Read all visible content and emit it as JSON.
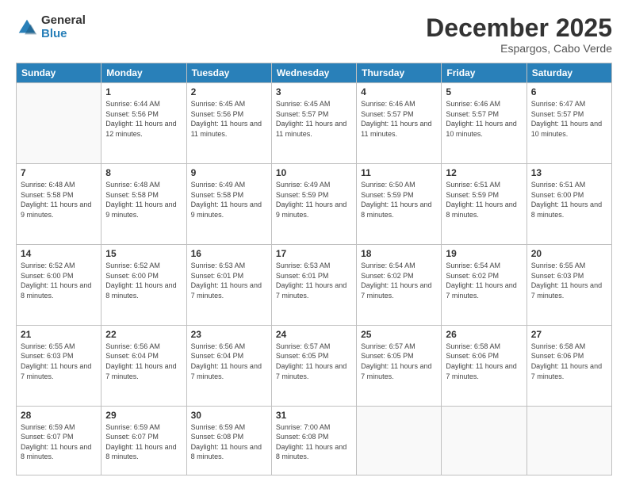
{
  "logo": {
    "general": "General",
    "blue": "Blue"
  },
  "header": {
    "month": "December 2025",
    "location": "Espargos, Cabo Verde"
  },
  "days_of_week": [
    "Sunday",
    "Monday",
    "Tuesday",
    "Wednesday",
    "Thursday",
    "Friday",
    "Saturday"
  ],
  "weeks": [
    [
      {
        "day": "",
        "sunrise": "",
        "sunset": "",
        "daylight": ""
      },
      {
        "day": "1",
        "sunrise": "Sunrise: 6:44 AM",
        "sunset": "Sunset: 5:56 PM",
        "daylight": "Daylight: 11 hours and 12 minutes."
      },
      {
        "day": "2",
        "sunrise": "Sunrise: 6:45 AM",
        "sunset": "Sunset: 5:56 PM",
        "daylight": "Daylight: 11 hours and 11 minutes."
      },
      {
        "day": "3",
        "sunrise": "Sunrise: 6:45 AM",
        "sunset": "Sunset: 5:57 PM",
        "daylight": "Daylight: 11 hours and 11 minutes."
      },
      {
        "day": "4",
        "sunrise": "Sunrise: 6:46 AM",
        "sunset": "Sunset: 5:57 PM",
        "daylight": "Daylight: 11 hours and 11 minutes."
      },
      {
        "day": "5",
        "sunrise": "Sunrise: 6:46 AM",
        "sunset": "Sunset: 5:57 PM",
        "daylight": "Daylight: 11 hours and 10 minutes."
      },
      {
        "day": "6",
        "sunrise": "Sunrise: 6:47 AM",
        "sunset": "Sunset: 5:57 PM",
        "daylight": "Daylight: 11 hours and 10 minutes."
      }
    ],
    [
      {
        "day": "7",
        "sunrise": "Sunrise: 6:48 AM",
        "sunset": "Sunset: 5:58 PM",
        "daylight": "Daylight: 11 hours and 9 minutes."
      },
      {
        "day": "8",
        "sunrise": "Sunrise: 6:48 AM",
        "sunset": "Sunset: 5:58 PM",
        "daylight": "Daylight: 11 hours and 9 minutes."
      },
      {
        "day": "9",
        "sunrise": "Sunrise: 6:49 AM",
        "sunset": "Sunset: 5:58 PM",
        "daylight": "Daylight: 11 hours and 9 minutes."
      },
      {
        "day": "10",
        "sunrise": "Sunrise: 6:49 AM",
        "sunset": "Sunset: 5:59 PM",
        "daylight": "Daylight: 11 hours and 9 minutes."
      },
      {
        "day": "11",
        "sunrise": "Sunrise: 6:50 AM",
        "sunset": "Sunset: 5:59 PM",
        "daylight": "Daylight: 11 hours and 8 minutes."
      },
      {
        "day": "12",
        "sunrise": "Sunrise: 6:51 AM",
        "sunset": "Sunset: 5:59 PM",
        "daylight": "Daylight: 11 hours and 8 minutes."
      },
      {
        "day": "13",
        "sunrise": "Sunrise: 6:51 AM",
        "sunset": "Sunset: 6:00 PM",
        "daylight": "Daylight: 11 hours and 8 minutes."
      }
    ],
    [
      {
        "day": "14",
        "sunrise": "Sunrise: 6:52 AM",
        "sunset": "Sunset: 6:00 PM",
        "daylight": "Daylight: 11 hours and 8 minutes."
      },
      {
        "day": "15",
        "sunrise": "Sunrise: 6:52 AM",
        "sunset": "Sunset: 6:00 PM",
        "daylight": "Daylight: 11 hours and 8 minutes."
      },
      {
        "day": "16",
        "sunrise": "Sunrise: 6:53 AM",
        "sunset": "Sunset: 6:01 PM",
        "daylight": "Daylight: 11 hours and 7 minutes."
      },
      {
        "day": "17",
        "sunrise": "Sunrise: 6:53 AM",
        "sunset": "Sunset: 6:01 PM",
        "daylight": "Daylight: 11 hours and 7 minutes."
      },
      {
        "day": "18",
        "sunrise": "Sunrise: 6:54 AM",
        "sunset": "Sunset: 6:02 PM",
        "daylight": "Daylight: 11 hours and 7 minutes."
      },
      {
        "day": "19",
        "sunrise": "Sunrise: 6:54 AM",
        "sunset": "Sunset: 6:02 PM",
        "daylight": "Daylight: 11 hours and 7 minutes."
      },
      {
        "day": "20",
        "sunrise": "Sunrise: 6:55 AM",
        "sunset": "Sunset: 6:03 PM",
        "daylight": "Daylight: 11 hours and 7 minutes."
      }
    ],
    [
      {
        "day": "21",
        "sunrise": "Sunrise: 6:55 AM",
        "sunset": "Sunset: 6:03 PM",
        "daylight": "Daylight: 11 hours and 7 minutes."
      },
      {
        "day": "22",
        "sunrise": "Sunrise: 6:56 AM",
        "sunset": "Sunset: 6:04 PM",
        "daylight": "Daylight: 11 hours and 7 minutes."
      },
      {
        "day": "23",
        "sunrise": "Sunrise: 6:56 AM",
        "sunset": "Sunset: 6:04 PM",
        "daylight": "Daylight: 11 hours and 7 minutes."
      },
      {
        "day": "24",
        "sunrise": "Sunrise: 6:57 AM",
        "sunset": "Sunset: 6:05 PM",
        "daylight": "Daylight: 11 hours and 7 minutes."
      },
      {
        "day": "25",
        "sunrise": "Sunrise: 6:57 AM",
        "sunset": "Sunset: 6:05 PM",
        "daylight": "Daylight: 11 hours and 7 minutes."
      },
      {
        "day": "26",
        "sunrise": "Sunrise: 6:58 AM",
        "sunset": "Sunset: 6:06 PM",
        "daylight": "Daylight: 11 hours and 7 minutes."
      },
      {
        "day": "27",
        "sunrise": "Sunrise: 6:58 AM",
        "sunset": "Sunset: 6:06 PM",
        "daylight": "Daylight: 11 hours and 7 minutes."
      }
    ],
    [
      {
        "day": "28",
        "sunrise": "Sunrise: 6:59 AM",
        "sunset": "Sunset: 6:07 PM",
        "daylight": "Daylight: 11 hours and 8 minutes."
      },
      {
        "day": "29",
        "sunrise": "Sunrise: 6:59 AM",
        "sunset": "Sunset: 6:07 PM",
        "daylight": "Daylight: 11 hours and 8 minutes."
      },
      {
        "day": "30",
        "sunrise": "Sunrise: 6:59 AM",
        "sunset": "Sunset: 6:08 PM",
        "daylight": "Daylight: 11 hours and 8 minutes."
      },
      {
        "day": "31",
        "sunrise": "Sunrise: 7:00 AM",
        "sunset": "Sunset: 6:08 PM",
        "daylight": "Daylight: 11 hours and 8 minutes."
      },
      {
        "day": "",
        "sunrise": "",
        "sunset": "",
        "daylight": ""
      },
      {
        "day": "",
        "sunrise": "",
        "sunset": "",
        "daylight": ""
      },
      {
        "day": "",
        "sunrise": "",
        "sunset": "",
        "daylight": ""
      }
    ]
  ]
}
